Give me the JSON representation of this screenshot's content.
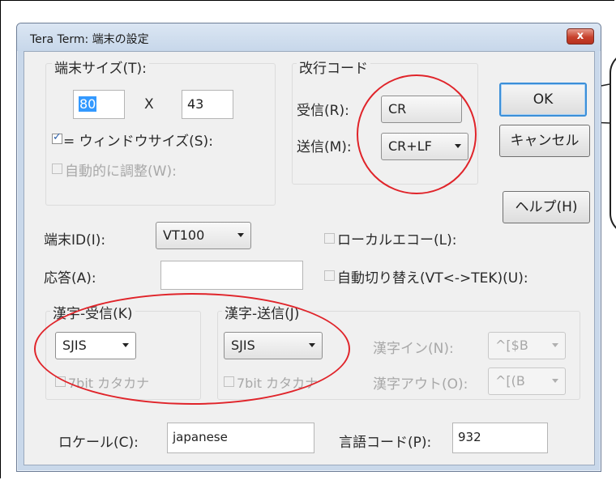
{
  "window": {
    "title": "Tera Term: 端末の設定",
    "close_label": "x"
  },
  "terminal_size": {
    "group_label": "端末サイズ(T):",
    "columns": "80",
    "separator": "X",
    "rows": "43",
    "eq_window_label": "= ウィンドウサイズ(S):",
    "eq_window_checked": true,
    "auto_resize_label": "自動的に調整(W):",
    "auto_resize_checked": false
  },
  "newline": {
    "group_label": "改行コード",
    "receive_label": "受信(R):",
    "receive_value": "CR",
    "transmit_label": "送信(M):",
    "transmit_value": "CR+LF"
  },
  "buttons": {
    "ok": "OK",
    "cancel": "キャンセル",
    "help": "ヘルプ(H)"
  },
  "terminal_id": {
    "label": "端末ID(I):",
    "value": "VT100"
  },
  "answerback": {
    "label": "応答(A):",
    "value": ""
  },
  "local_echo": {
    "label": "ローカルエコー(L):",
    "checked": false
  },
  "auto_switch": {
    "label": "自動切り替え(VT<->TEK)(U):",
    "checked": false
  },
  "kanji_receive": {
    "group_label": "漢字-受信(K)",
    "value": "SJIS",
    "katakana_label": "7bit カタカナ",
    "katakana_checked": false
  },
  "kanji_transmit": {
    "group_label": "漢字-送信(J)",
    "value": "SJIS",
    "katakana_label": "7bit カタカナ",
    "katakana_checked": false,
    "kanji_in_label": "漢字イン(N):",
    "kanji_in_value": "^[$B",
    "kanji_out_label": "漢字アウト(O):",
    "kanji_out_value": "^[(B"
  },
  "locale": {
    "label": "ロケール(C):",
    "value": "japanese"
  },
  "language_code": {
    "label": "言語コード(P):",
    "value": "932"
  },
  "colors": {
    "annotation": "#e0242a",
    "default_button_border": "#3c8fd8",
    "close_button": "#c7412c"
  }
}
